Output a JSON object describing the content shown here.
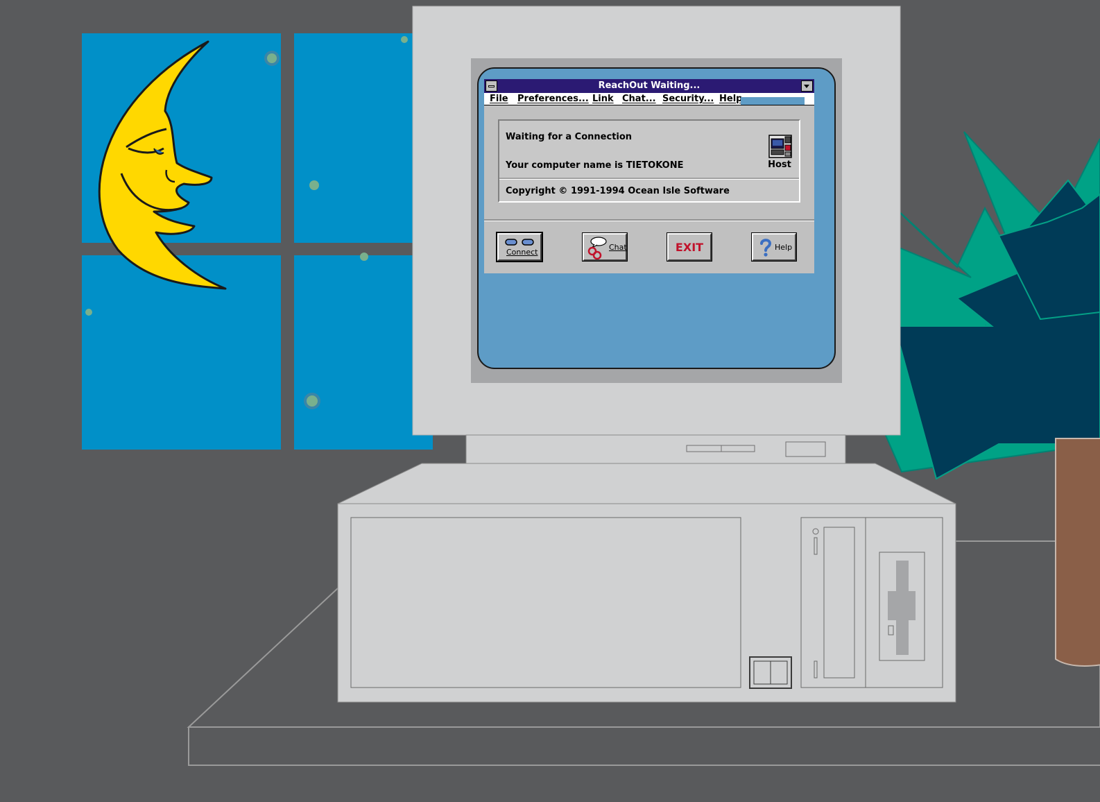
{
  "window": {
    "title": "ReachOut Waiting..."
  },
  "menu": {
    "file": "File",
    "preferences": "Preferences...",
    "link": "Link",
    "chat": "Chat...",
    "security": "Security...",
    "help": "Help"
  },
  "status": {
    "waiting": "Waiting for a Connection",
    "computer_name": "Your computer name is TIETOKONE",
    "copyright": "Copyright © 1991-1994 Ocean Isle Software",
    "host_label": "Host"
  },
  "toolbar": {
    "connect": "Connect",
    "chat": "Chat",
    "exit": "EXIT",
    "help": "Help"
  },
  "icons": {
    "system_menu": "system-menu-icon",
    "minimize": "minimize-arrow-icon",
    "host": "host-computer-icon",
    "connect": "connect-plugs-icon",
    "chat": "chat-bubble-chain-icon",
    "exit": "exit-sign-icon",
    "help": "question-mark-icon"
  },
  "colors": {
    "wall": "#595a5c",
    "window_sky": "#0190c8",
    "moon": "#ffd800",
    "screen": "#5e9cc6",
    "title_bar": "#2b1a73",
    "plant_light": "#00a286",
    "plant_dark": "#003b57",
    "pot": "#8a5f48",
    "exit_text": "#c1122b"
  }
}
